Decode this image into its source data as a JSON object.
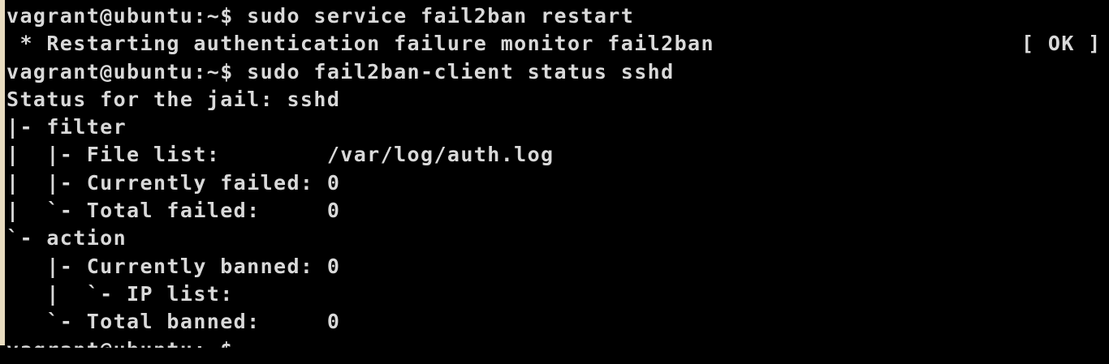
{
  "terminal": {
    "lines": [
      "vagrant@ubuntu:~$ sudo service fail2ban restart",
      " * Restarting authentication failure monitor fail2ban",
      "vagrant@ubuntu:~$ sudo fail2ban-client status sshd",
      "Status for the jail: sshd",
      "|- filter",
      "|  |- File list:        /var/log/auth.log",
      "|  |- Currently failed: 0",
      "|  `- Total failed:     0",
      "`- action",
      "   |- Currently banned: 0",
      "   |  `- IP list:",
      "   `- Total banned:     0",
      "vagrant@ubuntu:~$"
    ],
    "restart_status": "[ OK ]"
  },
  "colors": {
    "background": "#000000",
    "text": "#d9d9d9",
    "frame": "#e8dcc0"
  }
}
